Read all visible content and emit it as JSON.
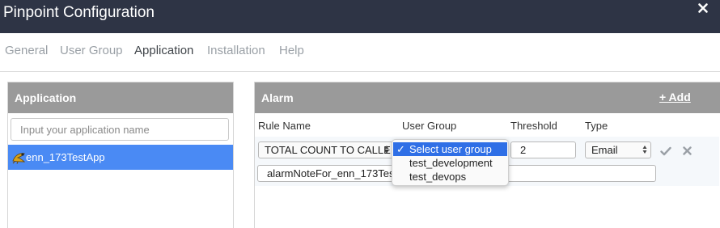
{
  "window": {
    "title": "Pinpoint Configuration",
    "close_icon": "close-icon"
  },
  "tabs": [
    {
      "label": "General",
      "active": false
    },
    {
      "label": "User Group",
      "active": false
    },
    {
      "label": "Application",
      "active": true
    },
    {
      "label": "Installation",
      "active": false
    },
    {
      "label": "Help",
      "active": false
    }
  ],
  "application_panel": {
    "title": "Application",
    "search": {
      "placeholder": "Input your application name",
      "value": ""
    },
    "items": [
      {
        "label": "enn_173TestApp",
        "icon": "java-app-icon",
        "selected": true
      }
    ]
  },
  "alarm_panel": {
    "title": "Alarm",
    "add_label": "+ Add",
    "columns": {
      "rule_name": "Rule Name",
      "user_group": "User Group",
      "threshold": "Threshold",
      "type": "Type"
    },
    "rule": {
      "rule_name": "TOTAL COUNT TO CALLE",
      "user_group": "Select user group",
      "threshold": "2",
      "type": "Email",
      "note": "alarmNoteFor_enn_173TestA"
    },
    "actions": {
      "confirm_icon": "check-icon",
      "remove_icon": "remove-icon"
    }
  },
  "user_group_dropdown": {
    "options": [
      "Select user group",
      "test_development",
      "test_devops"
    ],
    "selected_index": 0
  },
  "colors": {
    "titlebar": "#2e3445",
    "panel_header": "#9a9a9a",
    "selection": "#4a8af4",
    "dropdown_highlight": "#2f6fe6"
  }
}
